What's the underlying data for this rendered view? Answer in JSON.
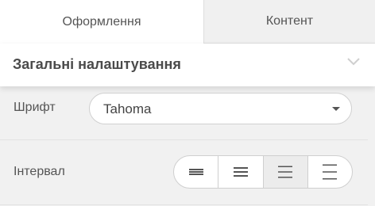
{
  "tabs": [
    {
      "label": "Оформлення",
      "active": true
    },
    {
      "label": "Контент",
      "active": false
    }
  ],
  "section": {
    "title": "Загальні налаштування",
    "chevron_icon": "chevron-down-icon"
  },
  "font": {
    "label": "Шрифт",
    "value": "Tahoma",
    "arrow_icon": "caret-down-icon"
  },
  "spacing": {
    "label": "Інтервал",
    "options": [
      {
        "icon": "line-spacing-tight-icon",
        "selected": false
      },
      {
        "icon": "line-spacing-normal-icon",
        "selected": false
      },
      {
        "icon": "line-spacing-wide-icon",
        "selected": true
      },
      {
        "icon": "line-spacing-extra-wide-icon",
        "selected": false
      }
    ]
  },
  "colors": {
    "background": "#f1f1f1",
    "panel": "#ffffff",
    "border": "#d0d0d0",
    "selected_segment": "#ececec",
    "text": "#444444"
  }
}
